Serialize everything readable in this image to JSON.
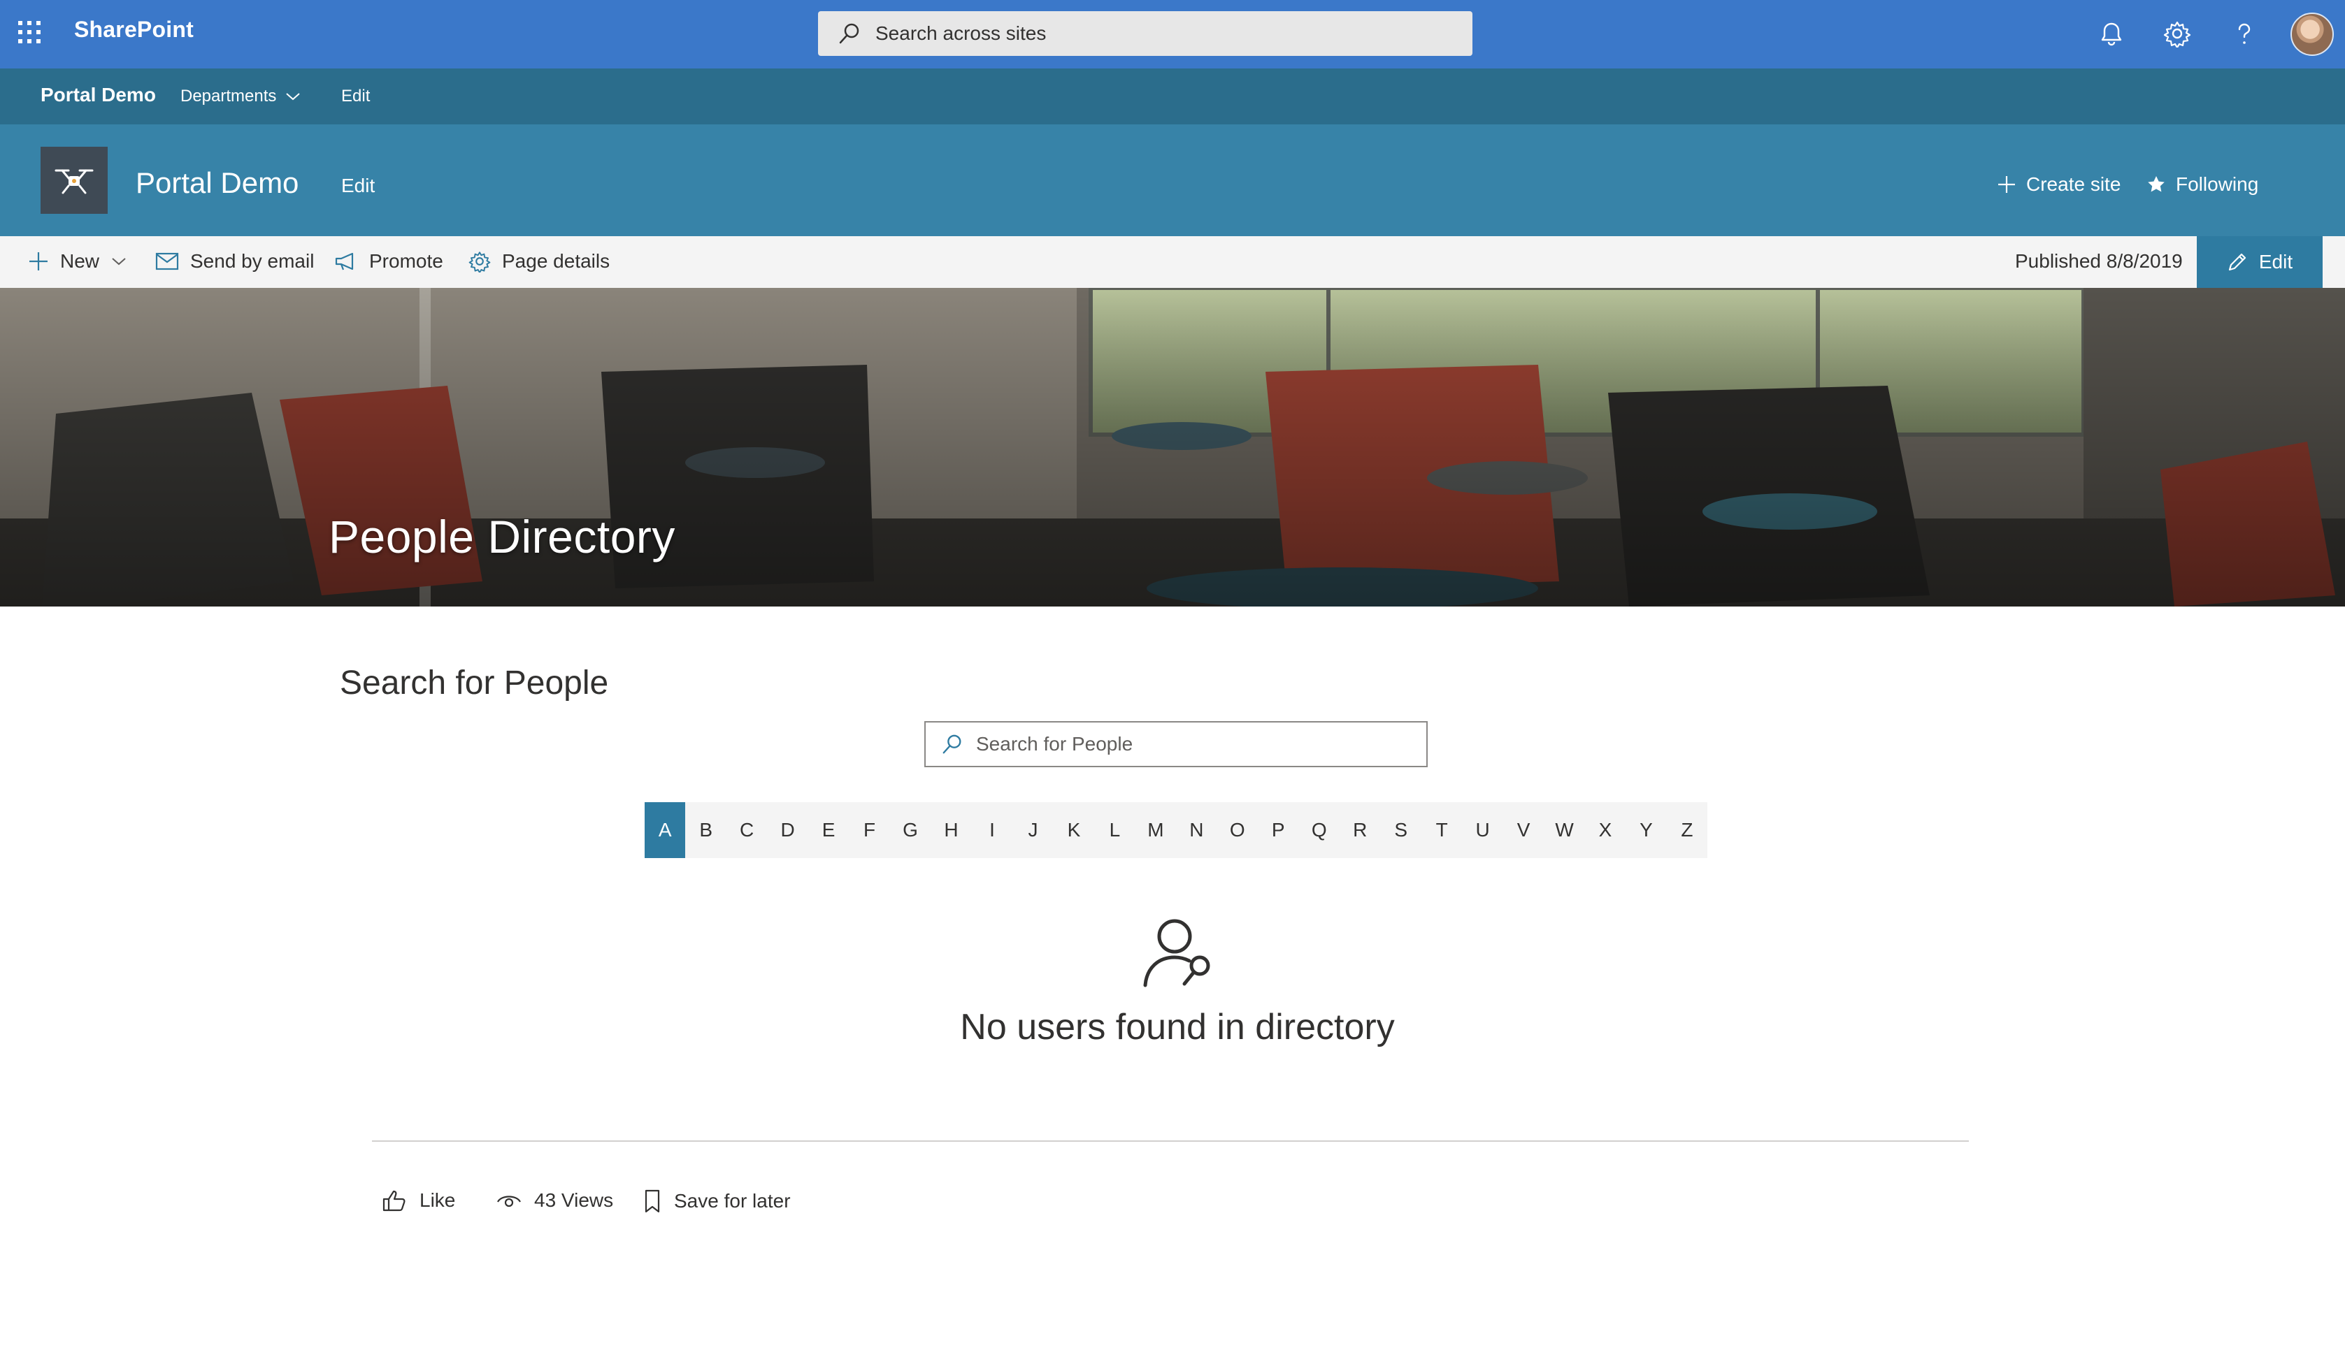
{
  "suite": {
    "app_name": "SharePoint",
    "search_placeholder": "Search across sites",
    "icons": [
      "app-launcher-icon",
      "search-icon",
      "bell-icon",
      "gear-icon",
      "help-icon"
    ],
    "accent": "#3b78c9"
  },
  "hub": {
    "title": "Portal Demo",
    "links": [
      {
        "label": "Departments"
      },
      {
        "label": "Edit"
      }
    ],
    "color": "#2b6d8c"
  },
  "site": {
    "title": "Portal Demo",
    "edit_label": "Edit",
    "create_site_label": "Create site",
    "following_label": "Following",
    "color": "#3783a8"
  },
  "commands": {
    "new_label": "New",
    "email_label": "Send by email",
    "promote_label": "Promote",
    "details_label": "Page details",
    "published": "Published 8/8/2019",
    "edit_label": "Edit"
  },
  "banner": {
    "title": "People Directory"
  },
  "directory": {
    "section_title": "Search for People",
    "search_placeholder": "Search for People",
    "letters": [
      "A",
      "B",
      "C",
      "D",
      "E",
      "F",
      "G",
      "H",
      "I",
      "J",
      "K",
      "L",
      "M",
      "N",
      "O",
      "P",
      "Q",
      "R",
      "S",
      "T",
      "U",
      "V",
      "W",
      "X",
      "Y",
      "Z"
    ],
    "active_letter": "A",
    "empty_message": "No users found in directory",
    "active_color": "#2e7ba1"
  },
  "social": {
    "like_label": "Like",
    "views_label": "43 Views",
    "save_label": "Save for later"
  }
}
